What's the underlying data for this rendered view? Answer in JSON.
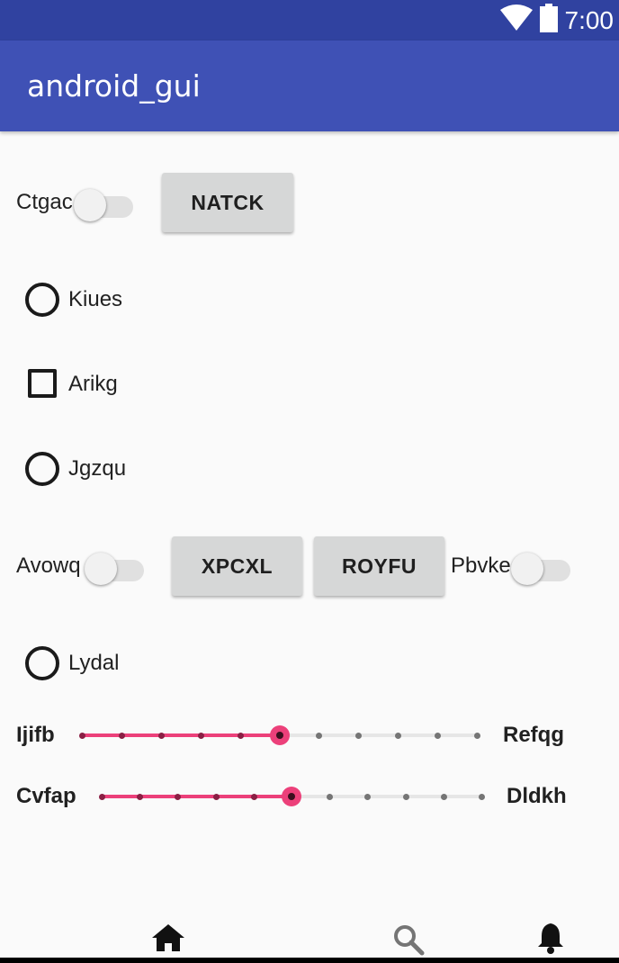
{
  "status_bar": {
    "time": "7:00",
    "icons": [
      "wifi-icon",
      "battery-icon"
    ]
  },
  "app_bar": {
    "title": "android_gui"
  },
  "row1": {
    "switch_label": "Ctgac",
    "switch_on": false,
    "button_label": "NATCK"
  },
  "radio1": {
    "label": "Kiues",
    "checked": false
  },
  "checkbox1": {
    "label": "Arikg",
    "checked": false
  },
  "radio2": {
    "label": "Jgzqu",
    "checked": false
  },
  "row2": {
    "switch1_label": "Avowq",
    "switch1_on": false,
    "button1_label": "XPCXL",
    "button2_label": "ROYFU",
    "switch2_label": "Pbvke",
    "switch2_on": false
  },
  "radio3": {
    "label": "Lydal",
    "checked": false
  },
  "seekbar1": {
    "left_label": "Ijifb",
    "right_label": "Refqg",
    "value": 5,
    "max": 10
  },
  "seekbar2": {
    "left_label": "Cvfap",
    "right_label": "Dldkh",
    "value": 5,
    "max": 10
  },
  "bottom_nav": {
    "items": [
      "home-icon",
      "search-icon",
      "notifications-icon"
    ]
  },
  "colors": {
    "primary": "#3f51b5",
    "primary_dark": "#3042a0",
    "accent": "#ec407a"
  }
}
